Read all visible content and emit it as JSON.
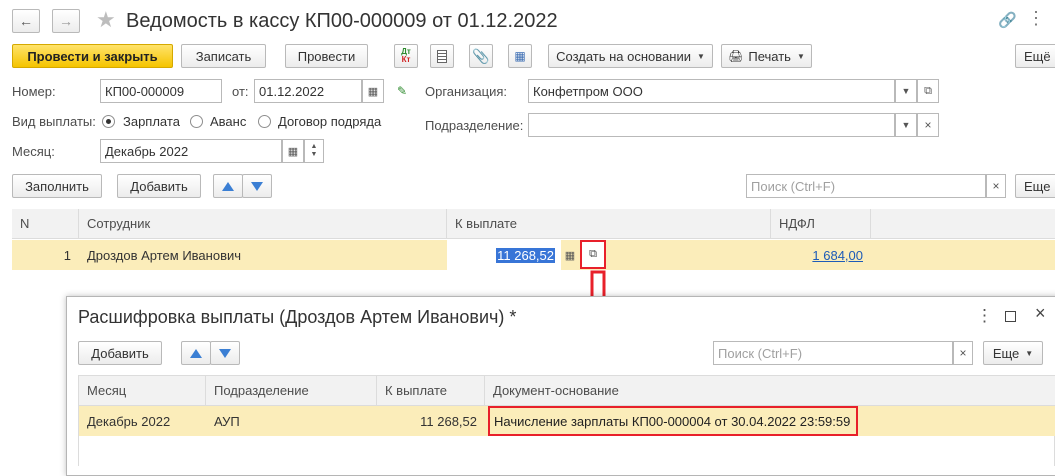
{
  "window": {
    "title": "Ведомость в кассу КП00-000009 от 01.12.2022"
  },
  "toolbar": {
    "post_close": "Провести и закрыть",
    "save": "Записать",
    "post": "Провести",
    "dtkt_top": "Дт",
    "dtkt_bottom": "Кт",
    "create_based": "Создать на основании",
    "print": "Печать",
    "more": "Ещё"
  },
  "form": {
    "number_label": "Номер:",
    "number_value": "КП00-000009",
    "date_label": "от:",
    "date_value": "01.12.2022",
    "org_label": "Организация:",
    "org_value": "Конфетпром ООО",
    "payment_type_label": "Вид выплаты:",
    "payment_types": [
      "Зарплата",
      "Аванс",
      "Договор подряда"
    ],
    "payment_type_selected": "Зарплата",
    "department_label": "Подразделение:",
    "department_value": "",
    "month_label": "Месяц:",
    "month_value": "Декабрь 2022"
  },
  "table_toolbar": {
    "fill": "Заполнить",
    "add": "Добавить",
    "search_placeholder": "Поиск (Ctrl+F)",
    "more": "Еще"
  },
  "table": {
    "columns": [
      "N",
      "Сотрудник",
      "К выплате",
      "НДФЛ"
    ],
    "rows": [
      {
        "n": "1",
        "employee": "Дроздов Артем Иванович",
        "payment": "11 268,52",
        "ndfl": "1 684,00"
      }
    ]
  },
  "dialog": {
    "title": "Расшифровка выплаты (Дроздов Артем Иванович) *",
    "add": "Добавить",
    "search_placeholder": "Поиск (Ctrl+F)",
    "more": "Еще",
    "columns": [
      "Месяц",
      "Подразделение",
      "К выплате",
      "Документ-основание"
    ],
    "rows": [
      {
        "month": "Декабрь 2022",
        "department": "АУП",
        "payment": "11 268,52",
        "document": "Начисление зарплаты КП00-000004 от 30.04.2022 23:59:59"
      }
    ]
  },
  "colors": {
    "primary_button": "#f5c400",
    "selected_row": "#fbedba",
    "annotation_red": "#e8202a",
    "link": "#1d5bb8",
    "arrow_blue": "#3b7fd4"
  }
}
